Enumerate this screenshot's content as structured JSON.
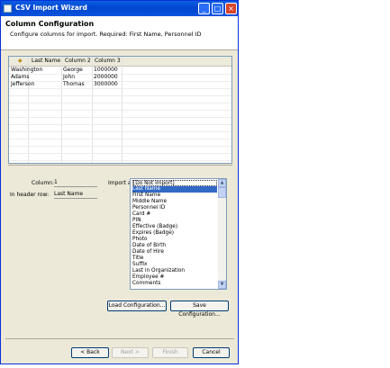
{
  "window": {
    "title": "CSV Import Wizard"
  },
  "header": {
    "title": "Column Configuration",
    "subtitle": "Configure columns for import.  Required: First Name, Personnel ID"
  },
  "table": {
    "columns": [
      "",
      "Last Name",
      "Column 2",
      "Column 3"
    ],
    "rows": [
      [
        "Washington",
        "George",
        "1000000"
      ],
      [
        "Adams",
        "John",
        "2000000"
      ],
      [
        "Jefferson",
        "Thomas",
        "3000000"
      ]
    ]
  },
  "config": {
    "column_label": "Column:",
    "column_value": "1",
    "header_label": "In header row:",
    "header_value": "Last Name",
    "import_label": "Import as:"
  },
  "import_options": [
    "[Do Not Import]",
    "Last Name",
    "First Name",
    "Middle Name",
    "Personnel ID",
    "Card #",
    "PIN",
    "Effective (Badge)",
    "Expires (Badge)",
    "Photo",
    "Date of Birth",
    "Date of Hire",
    "Title",
    "Suffix",
    "Last in Organization",
    "Employee #",
    "Comments"
  ],
  "selected_option": "Last Name",
  "buttons": {
    "load": "Load Configuration...",
    "save": "Save Configuration...",
    "back": "< Back",
    "next": "Next >",
    "finish": "Finish",
    "cancel": "Cancel"
  }
}
